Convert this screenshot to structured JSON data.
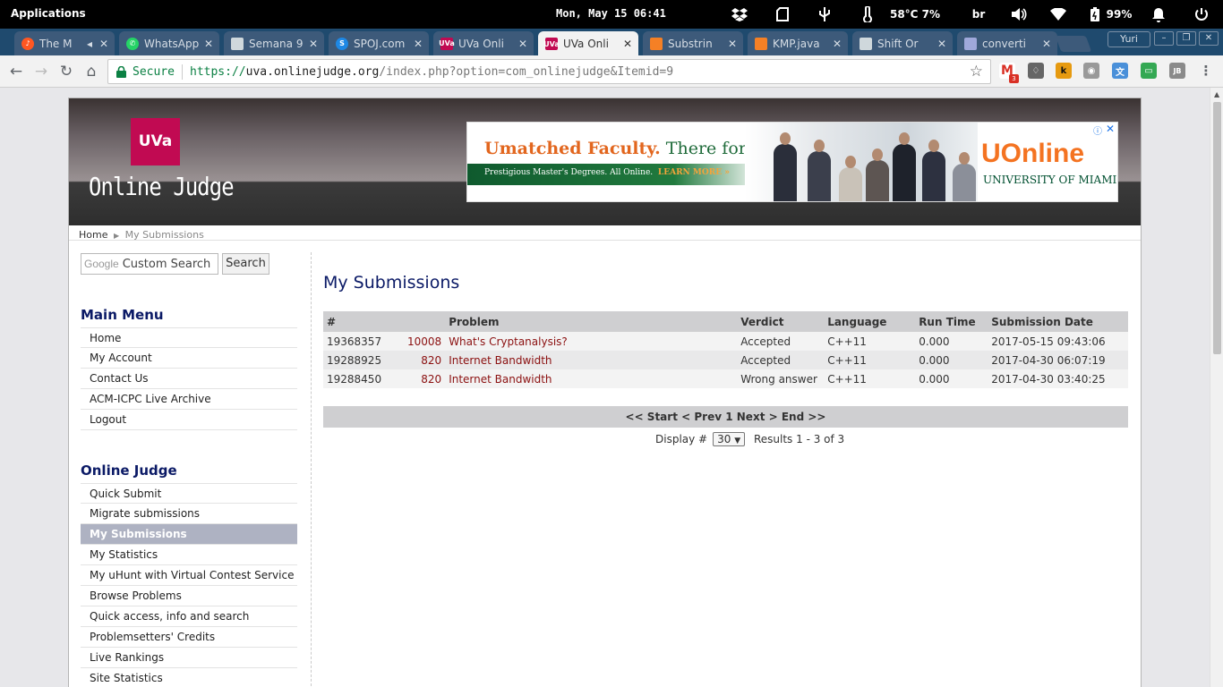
{
  "system_bar": {
    "apps_label": "Applications",
    "clock": "Mon, May 15  06:41",
    "temperature": "58°C 7%",
    "keyboard_layout": "br",
    "battery": "99%"
  },
  "tabs": [
    {
      "title": "The M",
      "favicon": "music-icon",
      "color": "#ff5722"
    },
    {
      "title": "WhatsApp",
      "favicon": "whatsapp-icon",
      "color": "#25d366"
    },
    {
      "title": "Semana 9",
      "favicon": "trello-icon",
      "color": "#cfd8dc"
    },
    {
      "title": "SPOJ.com",
      "favicon": "spoj-icon",
      "color": "#1e88e5"
    },
    {
      "title": "UVa Onli",
      "favicon": "uva-icon",
      "color": "#c10a52"
    },
    {
      "title": "UVa Onli",
      "favicon": "uva-icon",
      "color": "#c10a52",
      "active": true
    },
    {
      "title": "Substrin",
      "favicon": "princeton-icon",
      "color": "#f58025"
    },
    {
      "title": "KMP.java",
      "favicon": "princeton-icon",
      "color": "#f58025"
    },
    {
      "title": "Shift Or",
      "favicon": "document-icon",
      "color": "#cfd8dc"
    },
    {
      "title": "converti",
      "favicon": "link-icon",
      "color": "#9fa8da"
    }
  ],
  "profile_name": "Yuri",
  "toolbar": {
    "secure_label": "Secure",
    "url_scheme": "https://",
    "url_host": "uva.onlinejudge.org",
    "url_path": "/index.php?option=com_onlinejudge&Itemid=9",
    "gmail_badge": "3"
  },
  "site": {
    "logo_box": "UVa",
    "logo_text": "Online Judge",
    "ad": {
      "headline_orange": "Umatched Faculty.",
      "headline_green": " There for You.",
      "subline": "Prestigious Master's Degrees. All Online.",
      "learn_more": "LEARN MORE »",
      "brand_u": "U",
      "brand_online": "Online",
      "university": "UNIVERSITY OF MIAMI"
    },
    "breadcrumb": {
      "home": "Home",
      "current": "My Submissions"
    },
    "search": {
      "brand": "Google",
      "placeholder": "Custom Search",
      "button": "Search"
    },
    "main_menu": {
      "title": "Main Menu",
      "items": [
        "Home",
        "My Account",
        "Contact Us",
        "ACM-ICPC Live Archive",
        "Logout"
      ]
    },
    "judge_menu": {
      "title": "Online Judge",
      "items": [
        "Quick Submit",
        "Migrate submissions",
        "My Submissions",
        "My Statistics",
        "My uHunt with Virtual Contest Service",
        "Browse Problems",
        "Quick access, info and search",
        "Problemsetters' Credits",
        "Live Rankings",
        "Site Statistics"
      ],
      "selected": "My Submissions"
    }
  },
  "submissions": {
    "title": "My Submissions",
    "columns": [
      "#",
      "Problem",
      "Verdict",
      "Language",
      "Run Time",
      "Submission Date"
    ],
    "rows": [
      {
        "id": "19368357",
        "problem_id": "10008",
        "problem_name": "What's Cryptanalysis?",
        "verdict": "Accepted",
        "language": "C++11",
        "run_time": "0.000",
        "date": "2017-05-15 09:43:06"
      },
      {
        "id": "19288925",
        "problem_id": "820",
        "problem_name": "Internet Bandwidth",
        "verdict": "Accepted",
        "language": "C++11",
        "run_time": "0.000",
        "date": "2017-04-30 06:07:19"
      },
      {
        "id": "19288450",
        "problem_id": "820",
        "problem_name": "Internet Bandwidth",
        "verdict": "Wrong answer",
        "language": "C++11",
        "run_time": "0.000",
        "date": "2017-04-30 03:40:25"
      }
    ],
    "pager": {
      "start": "<< Start",
      "prev": "< Prev",
      "page": "1",
      "next": "Next >",
      "end": "End >>"
    },
    "display_label": "Display #",
    "display_value": "30",
    "results": "Results 1 - 3 of 3"
  }
}
